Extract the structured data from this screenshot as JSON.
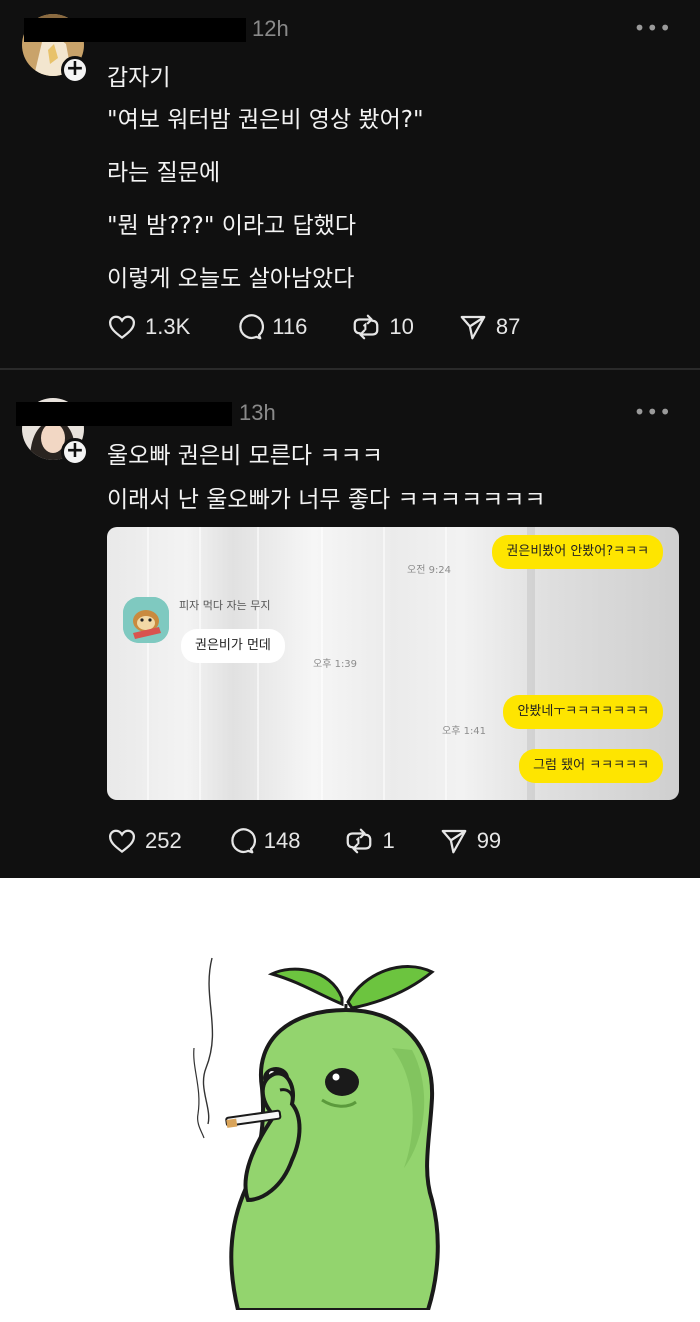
{
  "posts": [
    {
      "time": "12h",
      "more": "•••",
      "lines": [
        "갑자기",
        "\"여보 워터밤 권은비 영상 봤어?\"",
        "라는 질문에",
        "\"뭔 밤???\" 이라고 답했다",
        "이렇게 오늘도 살아남았다"
      ],
      "likes": "1.3K",
      "comments": "116",
      "reposts": "10",
      "shares": "87"
    },
    {
      "time": "13h",
      "more": "•••",
      "lines": [
        "울오빠 권은비 모른다 ㅋㅋㅋ",
        "이래서 난 울오빠가 너무 좋다 ㅋㅋㅋㅋㅋㅋㅋ"
      ],
      "likes": "252",
      "comments": "148",
      "reposts": "1",
      "shares": "99",
      "chat": {
        "sender_name": "피자 먹다 자는 무지",
        "messages": [
          {
            "side": "right",
            "text": "권은비봤어 안봤어?ㅋㅋㅋ",
            "time": "오전 9:24"
          },
          {
            "side": "left",
            "text": "권은비가 먼데",
            "time": "오후 1:39"
          },
          {
            "side": "right",
            "text": "안봤네ㅜㅋㅋㅋㅋㅋㅋㅋ",
            "time": "오후 1:41"
          },
          {
            "side": "right",
            "text": "그럼 됐어 ㅋㅋㅋㅋㅋ",
            "time": ""
          }
        ]
      }
    }
  ],
  "icons": {
    "like": "heart-icon",
    "comment": "comment-bubble-icon",
    "repost": "repost-icon",
    "share": "send-icon",
    "more": "more-dots-icon",
    "follow": "plus-icon"
  },
  "colors": {
    "background": "#101010",
    "kakao_yellow": "#fee500",
    "sprout_green": "#8fd46a"
  }
}
